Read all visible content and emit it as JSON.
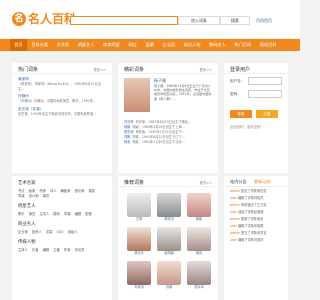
{
  "header": {
    "logo_mark": "名",
    "logo_text": "名人百科",
    "search_button": "进入词条",
    "search_button2": "搜索",
    "link": "百科首页"
  },
  "nav": [
    "首页",
    "百科分类",
    "艺术家",
    "明星艺人",
    "体育明星",
    "网红",
    "富豪",
    "企业家",
    "政治人物",
    "数码名人",
    "热门百科",
    "随机百科"
  ],
  "hot": {
    "title": "热门词条",
    "more": "更多>>",
    "items": [
      {
        "name": "黄家驹",
        "desc": "（黄家驹） 黄家驹（Wong Ka Kui），1962年6月10日出生..."
      },
      {
        "name": "许魏洲",
        "desc": "（许魏洲）许魏洲，中国内地男演员、歌手，1991年..."
      },
      {
        "name": "张艺谋（导演）",
        "desc": "张艺谋，1950年出生于陕西省西安市，中国内地导演..."
      }
    ]
  },
  "featured": {
    "title": "精彩词条",
    "more": "更多>>",
    "name": "杨子姗",
    "text": "杨子姗，1989年11月6日出生于广东省广州市，中国内地影视女演员，毕业于北京电影学院表演系。2011年，主演都市爱情剧《男人帮》...",
    "news": [
      {
        "name": "刘亦菲",
        "text": "刘亦菲，1987年8月25日出生于湖北..."
      },
      {
        "name": "杨颖",
        "text": "杨颖，1989年2月28日出生于上海..."
      },
      {
        "name": "周冬雨",
        "text": "周冬雨，1992年1月31日出生于..."
      },
      {
        "name": "郑爽",
        "text": "郑爽，1991年8月22日出生于辽宁..."
      },
      {
        "name": "杨紫",
        "text": "杨紫，1992年11月6日出生于北京..."
      }
    ]
  },
  "login": {
    "title": "登录用户",
    "user_label": "用户名：",
    "pass_label": "密码：",
    "login_btn": "登录",
    "reg_btn": "注册",
    "foot": "忘记密码？ 如何注册？"
  },
  "categories": {
    "title": "艺术名家",
    "groups": [
      {
        "name": "艺术名家",
        "tags": [
          "书法",
          "画家",
          "作家",
          "诗人",
          "舞蹈家",
          "音乐家",
          "摄影",
          "导演",
          "设计师",
          "演员"
        ]
      },
      {
        "name": "明星艺人",
        "tags": [
          "歌手",
          "演员",
          "主持人",
          "模特",
          "导演",
          "编剧",
          "配音"
        ]
      },
      {
        "name": "商业名人",
        "tags": [
          "企业家",
          "投资人",
          "富豪",
          "CEO",
          "创始人"
        ]
      },
      {
        "name": "传媒人物",
        "tags": [
          "主持人",
          "记者",
          "编辑",
          "主播",
          "作家",
          "评论员"
        ]
      }
    ]
  },
  "photos": {
    "title": "推荐词条",
    "more": "更多>>",
    "items": [
      "王菲",
      "陈奕迅",
      "杨幂",
      "林志玲",
      "赵丽颖",
      "周迅",
      "刘诗诗",
      "孙俪",
      "范冰冰"
    ]
  },
  "notice": {
    "tab_a": "站内公告",
    "tab_b": "最新动态",
    "items": [
      {
        "who": "admin",
        "text": "提交了词条周杰伦"
      },
      {
        "who": "user",
        "text": "编辑了词条林俊杰"
      },
      {
        "who": "admin",
        "text": "审核通过了王力宏"
      },
      {
        "who": "user",
        "text": "创建了词条赵丽颖"
      },
      {
        "who": "admin",
        "text": "更新了词条吴京"
      },
      {
        "who": "user",
        "text": "编辑了词条邓紫棋"
      },
      {
        "who": "admin",
        "text": "提交了词条张学友"
      },
      {
        "who": "user",
        "text": "编辑了词条刘德华"
      }
    ]
  },
  "colors": {
    "brand": "#f08a1f",
    "link": "#3a6ea5"
  }
}
